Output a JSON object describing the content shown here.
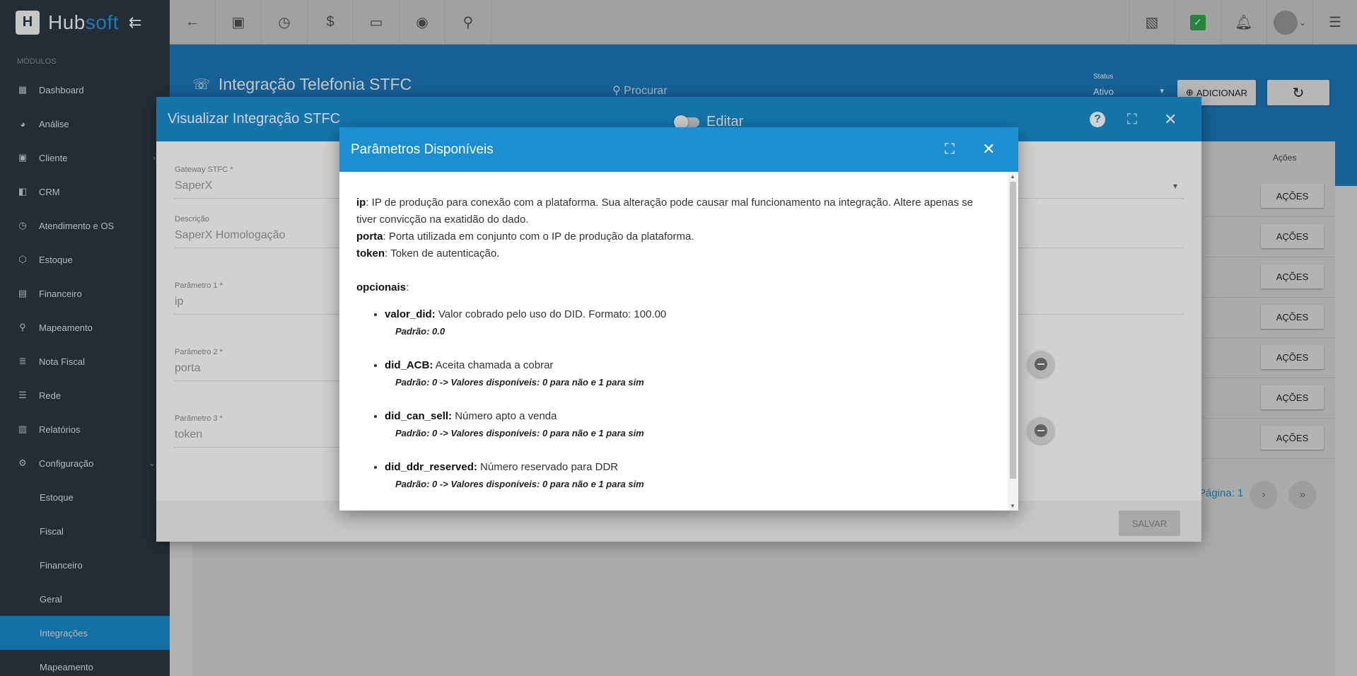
{
  "app": {
    "brand_prefix": "Hub",
    "brand_suffix": "soft",
    "logo_letter": "H"
  },
  "sidebar": {
    "section_label": "MÓDULOS",
    "items": [
      {
        "label": "Dashboard",
        "icon": "grid-icon"
      },
      {
        "label": "Análise",
        "icon": "pie-chart-icon"
      },
      {
        "label": "Cliente",
        "icon": "contact-card-icon"
      },
      {
        "label": "CRM",
        "icon": "crm-board-icon"
      },
      {
        "label": "Atendimento e OS",
        "icon": "calendar-clock-icon"
      },
      {
        "label": "Estoque",
        "icon": "box-icon"
      },
      {
        "label": "Financeiro",
        "icon": "money-icon"
      },
      {
        "label": "Mapeamento",
        "icon": "map-pin-icon"
      },
      {
        "label": "Nota Fiscal",
        "icon": "receipt-icon"
      },
      {
        "label": "Rede",
        "icon": "server-icon"
      },
      {
        "label": "Relatórios",
        "icon": "report-icon"
      },
      {
        "label": "Configuração",
        "icon": "gear-icon"
      }
    ],
    "sub_items": [
      "Estoque",
      "Fiscal",
      "Financeiro",
      "Geral",
      "Integrações",
      "Mapeamento"
    ]
  },
  "page": {
    "title": "Integração Telefonia STFC",
    "search_placeholder": "Procurar",
    "status_label": "Status",
    "status_value": "Ativo",
    "add_label": "ADICIONAR",
    "table_actions_header": "Ações",
    "actions_label": "AÇÕES",
    "pagination_label": "Página: 1"
  },
  "modal1": {
    "title": "Visualizar Integração STFC",
    "toggle_label": "Editar",
    "fields": [
      {
        "label": "Gateway STFC *",
        "value": "SaperX"
      },
      {
        "label": "Descrição",
        "value": "SaperX Homologação"
      },
      {
        "label": "Parâmetro 1 *",
        "value": "ip"
      },
      {
        "label": "Parâmetro 2 *",
        "value": "porta"
      },
      {
        "label": "Parâmetro 3 *",
        "value": "token"
      }
    ],
    "save_label": "SALVAR"
  },
  "modal2": {
    "title": "Parâmetros Disponíveis",
    "params": [
      {
        "name": "ip",
        "desc": ": IP de produção para conexão com a plataforma. Sua alteração pode causar mal funcionamento na integração. Altere apenas se tiver convicção na exatidão do dado."
      },
      {
        "name": "porta",
        "desc": ": Porta utilizada em conjunto com o IP de produção da plataforma."
      },
      {
        "name": "token",
        "desc": ": Token de autenticação."
      }
    ],
    "optional_title": "opcionais",
    "optional_colon": ":",
    "optionals": [
      {
        "name": "valor_did:",
        "desc": " Valor cobrado pelo uso do DID. Formato: 100.00",
        "default": "Padrão: 0.0"
      },
      {
        "name": "did_ACB:",
        "desc": " Aceita chamada a cobrar",
        "default": "Padrão: 0 -> Valores disponíveis: 0 para não e 1 para sim"
      },
      {
        "name": "did_can_sell:",
        "desc": " Número apto a venda",
        "default": "Padrão: 0 -> Valores disponíveis: 0 para não e 1 para sim"
      },
      {
        "name": "did_ddr_reserved:",
        "desc": " Número reservado para DDR",
        "default": "Padrão: 0 -> Valores disponíveis: 0 para não e 1 para sim"
      }
    ]
  },
  "colors": {
    "primary": "#1a8fd1",
    "sidebar": "#2d3a44",
    "topbar": "#cfcfcf",
    "success": "#2fa84f"
  }
}
